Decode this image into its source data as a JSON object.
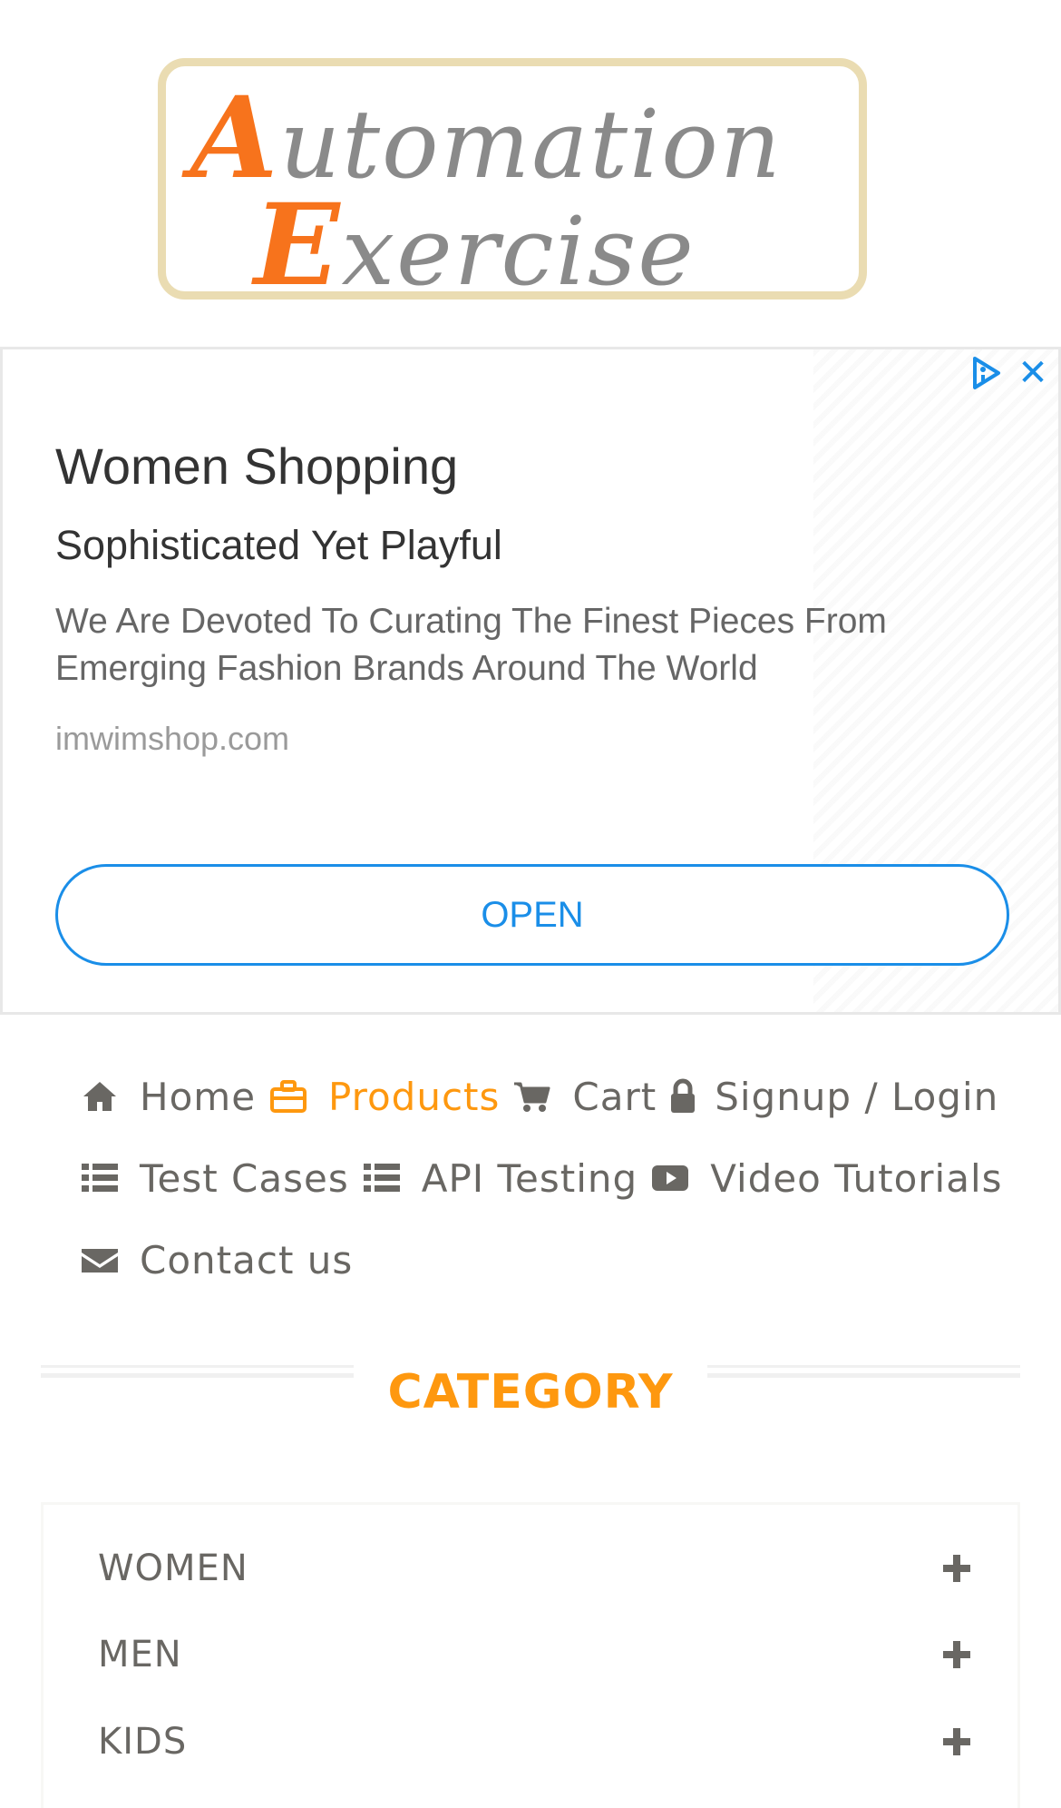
{
  "logo": {
    "line1_cap": "A",
    "line1_rest": "utomation",
    "line2_cap": "E",
    "line2_rest": "xercise"
  },
  "ad": {
    "headline": "Women Shopping",
    "subheadline": "Sophisticated Yet Playful",
    "description": "We Are Devoted To Curating The Finest Pieces From Emerging Fashion Brands Around The World",
    "domain": "imwimshop.com",
    "cta": "OPEN",
    "icons": [
      "adchoices-icon",
      "close-icon"
    ],
    "accent_color": "#1a8ee8"
  },
  "nav": {
    "items": [
      {
        "label": "Home",
        "icon": "home-icon",
        "active": false
      },
      {
        "label": "Products",
        "icon": "briefcase-icon",
        "active": true
      },
      {
        "label": "Cart",
        "icon": "cart-icon",
        "active": false
      },
      {
        "label": "Signup / Login",
        "icon": "lock-icon",
        "active": false
      },
      {
        "label": "Test Cases",
        "icon": "list-icon",
        "active": false
      },
      {
        "label": "API Testing",
        "icon": "list-icon",
        "active": false
      },
      {
        "label": "Video Tutorials",
        "icon": "youtube-play-icon",
        "active": false
      },
      {
        "label": "Contact us",
        "icon": "envelope-icon",
        "active": false
      }
    ],
    "active_color": "#fe980f",
    "text_color": "#696763"
  },
  "category": {
    "title": "CATEGORY",
    "items": [
      {
        "label": "WOMEN",
        "icon": "plus-icon"
      },
      {
        "label": "MEN",
        "icon": "plus-icon"
      },
      {
        "label": "KIDS",
        "icon": "plus-icon"
      }
    ]
  }
}
